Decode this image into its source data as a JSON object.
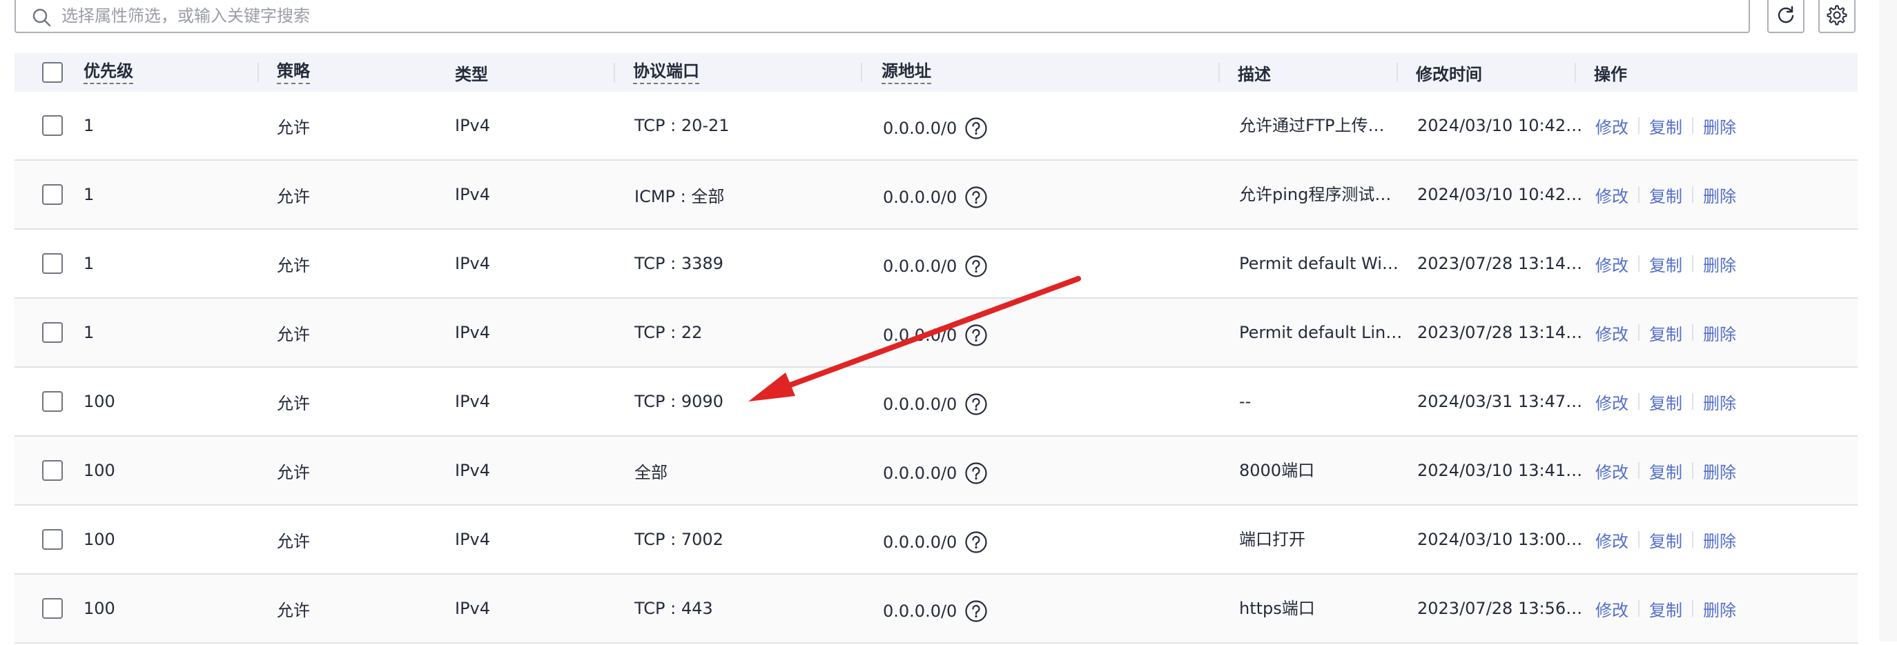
{
  "search": {
    "placeholder": "选择属性筛选，或输入关键字搜索",
    "value": ""
  },
  "toolbar": {
    "refresh_icon": "refresh-icon",
    "settings_icon": "gear-icon"
  },
  "table": {
    "headers": {
      "priority": "优先级",
      "policy": "策略",
      "type": "类型",
      "protocol_port": "协议端口",
      "source": "源地址",
      "description": "描述",
      "modified": "修改时间",
      "actions": "操作"
    },
    "action_labels": [
      "修改",
      "复制",
      "删除"
    ],
    "rows": [
      {
        "priority": "1",
        "policy": "允许",
        "type": "IPv4",
        "protocol_port": "TCP : 20-21",
        "source": "0.0.0.0/0",
        "description": "允许通过FTP上传…",
        "modified": "2024/03/10 10:42…"
      },
      {
        "priority": "1",
        "policy": "允许",
        "type": "IPv4",
        "protocol_port": "ICMP : 全部",
        "source": "0.0.0.0/0",
        "description": "允许ping程序测试…",
        "modified": "2024/03/10 10:42…"
      },
      {
        "priority": "1",
        "policy": "允许",
        "type": "IPv4",
        "protocol_port": "TCP : 3389",
        "source": "0.0.0.0/0",
        "description": "Permit default Wi…",
        "modified": "2023/07/28 13:14…"
      },
      {
        "priority": "1",
        "policy": "允许",
        "type": "IPv4",
        "protocol_port": "TCP : 22",
        "source": "0.0.0.0/0",
        "description": "Permit default Lin…",
        "modified": "2023/07/28 13:14…"
      },
      {
        "priority": "100",
        "policy": "允许",
        "type": "IPv4",
        "protocol_port": "TCP : 9090",
        "source": "0.0.0.0/0",
        "description": "--",
        "modified": "2024/03/31 13:47…"
      },
      {
        "priority": "100",
        "policy": "允许",
        "type": "IPv4",
        "protocol_port": "全部",
        "source": "0.0.0.0/0",
        "description": "8000端口",
        "modified": "2024/03/10 13:41…"
      },
      {
        "priority": "100",
        "policy": "允许",
        "type": "IPv4",
        "protocol_port": "TCP : 7002",
        "source": "0.0.0.0/0",
        "description": "端口打开",
        "modified": "2024/03/10 13:00…"
      },
      {
        "priority": "100",
        "policy": "允许",
        "type": "IPv4",
        "protocol_port": "TCP : 443",
        "source": "0.0.0.0/0",
        "description": "https端口",
        "modified": "2023/07/28 13:56…"
      }
    ]
  },
  "annotation": {
    "arrow_color": "#e02424",
    "points_to": "TCP : 9090"
  },
  "colors": {
    "link": "#526ecc",
    "header_bg": "#f2f4f9",
    "text": "#252b3a"
  }
}
